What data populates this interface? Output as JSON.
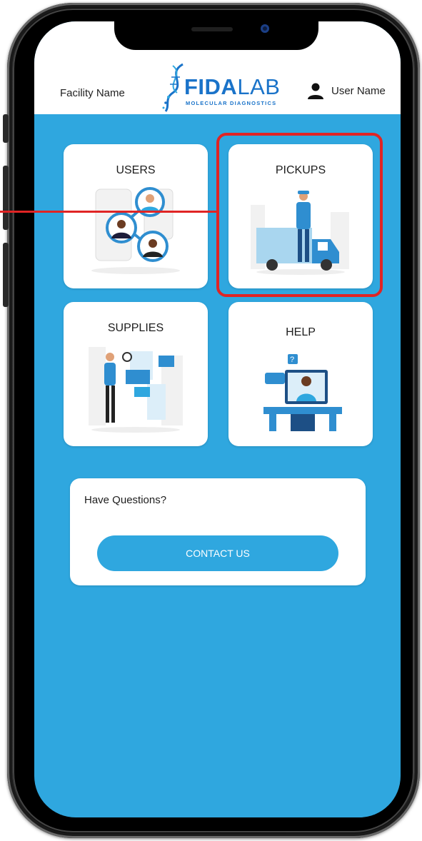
{
  "header": {
    "facility_name": "Facility Name",
    "logo_main_bold": "FIDA",
    "logo_main_light": "LAB",
    "logo_tagline": "MOLECULAR DIAGNOSTICS",
    "user_name": "User Name"
  },
  "tiles": [
    {
      "label": "USERS",
      "icon": "users-illustration"
    },
    {
      "label": "PICKUPS",
      "icon": "delivery-truck-illustration"
    },
    {
      "label": "SUPPLIES",
      "icon": "documents-illustration"
    },
    {
      "label": "HELP",
      "icon": "support-agent-illustration"
    }
  ],
  "questions": {
    "title": "Have Questions?",
    "button_label": "CONTACT US"
  },
  "colors": {
    "screen_background": "#2fa7df",
    "brand_blue": "#1a73c9",
    "highlight_red": "#e02424",
    "card_background": "#ffffff"
  }
}
